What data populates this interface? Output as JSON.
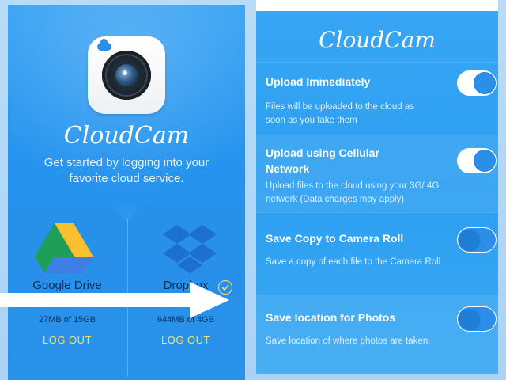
{
  "left": {
    "app_name": "CloudCam",
    "tagline": "Get started by logging into your favorite cloud service.",
    "services": [
      {
        "name": "Google Drive",
        "usage": "27MB of 15GB",
        "action": "LOG OUT"
      },
      {
        "name": "Dropbox",
        "usage": "644MB of 4GB",
        "action": "LOG OUT"
      }
    ]
  },
  "right": {
    "app_name": "CloudCam",
    "settings": [
      {
        "title": "Upload Immediately",
        "desc": "Files will be uploaded to the cloud as soon as you take them",
        "enabled": true
      },
      {
        "title": "Upload using Cellular Network",
        "desc": "Upload files to the cloud using your 3G/ 4G network (Data charges may apply)",
        "enabled": true
      },
      {
        "title": "Save Copy to Camera Roll",
        "desc": "Save a copy of each file to the Camera Roll",
        "enabled": false
      },
      {
        "title": "Save location for Photos",
        "desc": "Save location of where photos are taken.",
        "enabled": false
      }
    ]
  },
  "colors": {
    "accent": "#2b8ee8",
    "logout": "#f3e36a"
  }
}
